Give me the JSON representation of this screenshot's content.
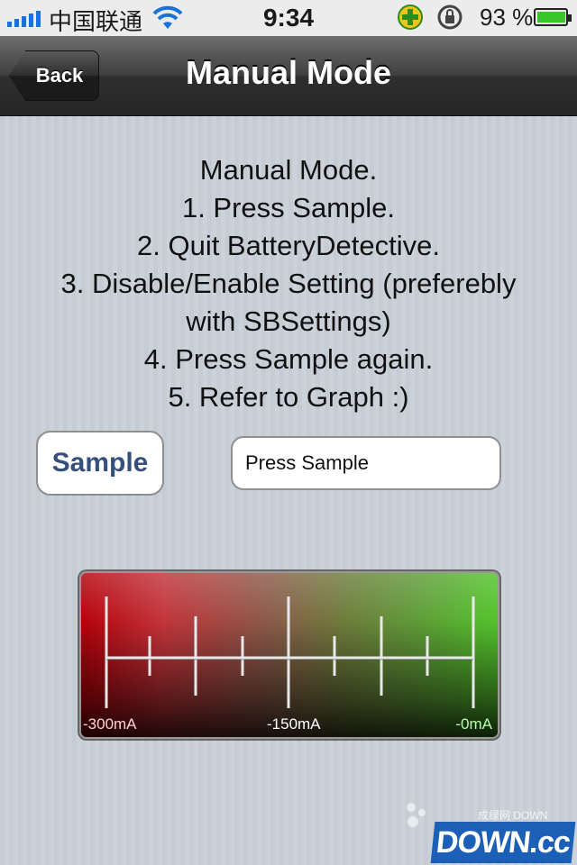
{
  "status_bar": {
    "carrier": "中国联通",
    "time": "9:34",
    "battery_percent": "93 %",
    "battery_level": 0.93,
    "icons": [
      "signal-icon",
      "wifi-icon",
      "plus-icon",
      "rotation-lock-icon",
      "battery-icon"
    ]
  },
  "nav": {
    "back_label": "Back",
    "title": "Manual Mode"
  },
  "instructions": [
    "Manual Mode.",
    "1. Press Sample.",
    "2. Quit BatteryDetective.",
    "3. Disable/Enable Setting (preferebly",
    "with SBSettings)",
    "4. Press Sample again.",
    "5. Refer to Graph :)"
  ],
  "sample_button": {
    "label": "Sample"
  },
  "status_field": {
    "value": "Press Sample"
  },
  "meter": {
    "labels": [
      "-300mA",
      "-150mA",
      "-0mA"
    ],
    "colors": {
      "low": "#b5000a",
      "high": "#52c42a"
    }
  },
  "watermark": {
    "small": "成绿网 DOWN",
    "logo": "DOWN.cc"
  }
}
